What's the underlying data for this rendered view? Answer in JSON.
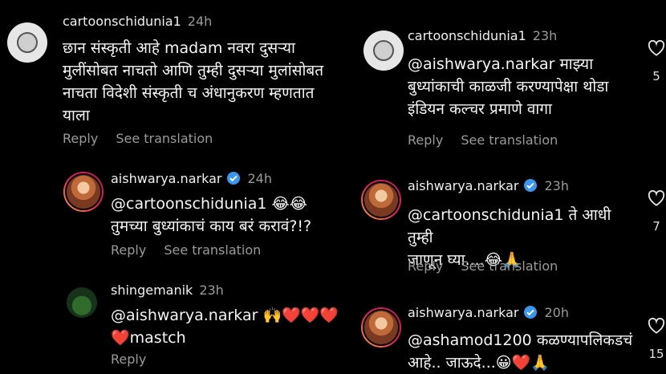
{
  "left": {
    "c1": {
      "username": "cartoonschidunia1",
      "time": "24h",
      "lines": [
        "छान संस्कृती आहे madam नवरा दुसऱ्या",
        "मुलींसोबत नाचतो आणि तुम्ही दुसऱ्या मुलांसोबत",
        "नाचता विदेशी संस्कृती च अंधानुकरण म्हणतात",
        "याला"
      ],
      "reply": "Reply",
      "see_translation": "See translation"
    },
    "c2": {
      "username": "aishwarya.narkar",
      "time": "24h",
      "lines": [
        "@cartoonschidunia1 😂😂",
        "तुमच्या बुध्यांकाचं  काय बरं करावं?!?"
      ],
      "reply": "Reply",
      "see_translation": "See translation"
    },
    "c3": {
      "username": "shingemanik",
      "time": "23h",
      "lines": [
        "@aishwarya.narkar 🙌❤️❤️❤️",
        "❤️mastch"
      ],
      "reply": "Reply"
    }
  },
  "right": {
    "c1": {
      "username": "cartoonschidunia1",
      "time": "23h",
      "lines": [
        "@aishwarya.narkar माझ्या",
        "बुध्यांकाची काळजी करण्यापेक्षा थोडा",
        "इंडियन कल्चर प्रमाणे वागा"
      ],
      "reply": "Reply",
      "see_translation": "See translation",
      "likes": "5"
    },
    "c2": {
      "username": "aishwarya.narkar",
      "time": "23h",
      "lines": [
        "@cartoonschidunia1 ते आधी तुम्ही",
        "जाणून घ्या....😂🙏"
      ],
      "reply": "Reply",
      "see_translation": "See translation",
      "likes": "7"
    },
    "c3": {
      "username": "aishwarya.narkar",
      "time": "20h",
      "lines": [
        "@ashamod1200 कळण्यापलिकडचं",
        "आहे.. जाऊदे...😀❤️🙏"
      ],
      "likes": "15"
    }
  },
  "colors": {
    "background": "#000000",
    "secondary_text": "#9a9a9a",
    "verified": "#3897f0",
    "heart": "#e0245e"
  },
  "icons": [
    "heart-outline-icon",
    "verified-badge-icon"
  ]
}
